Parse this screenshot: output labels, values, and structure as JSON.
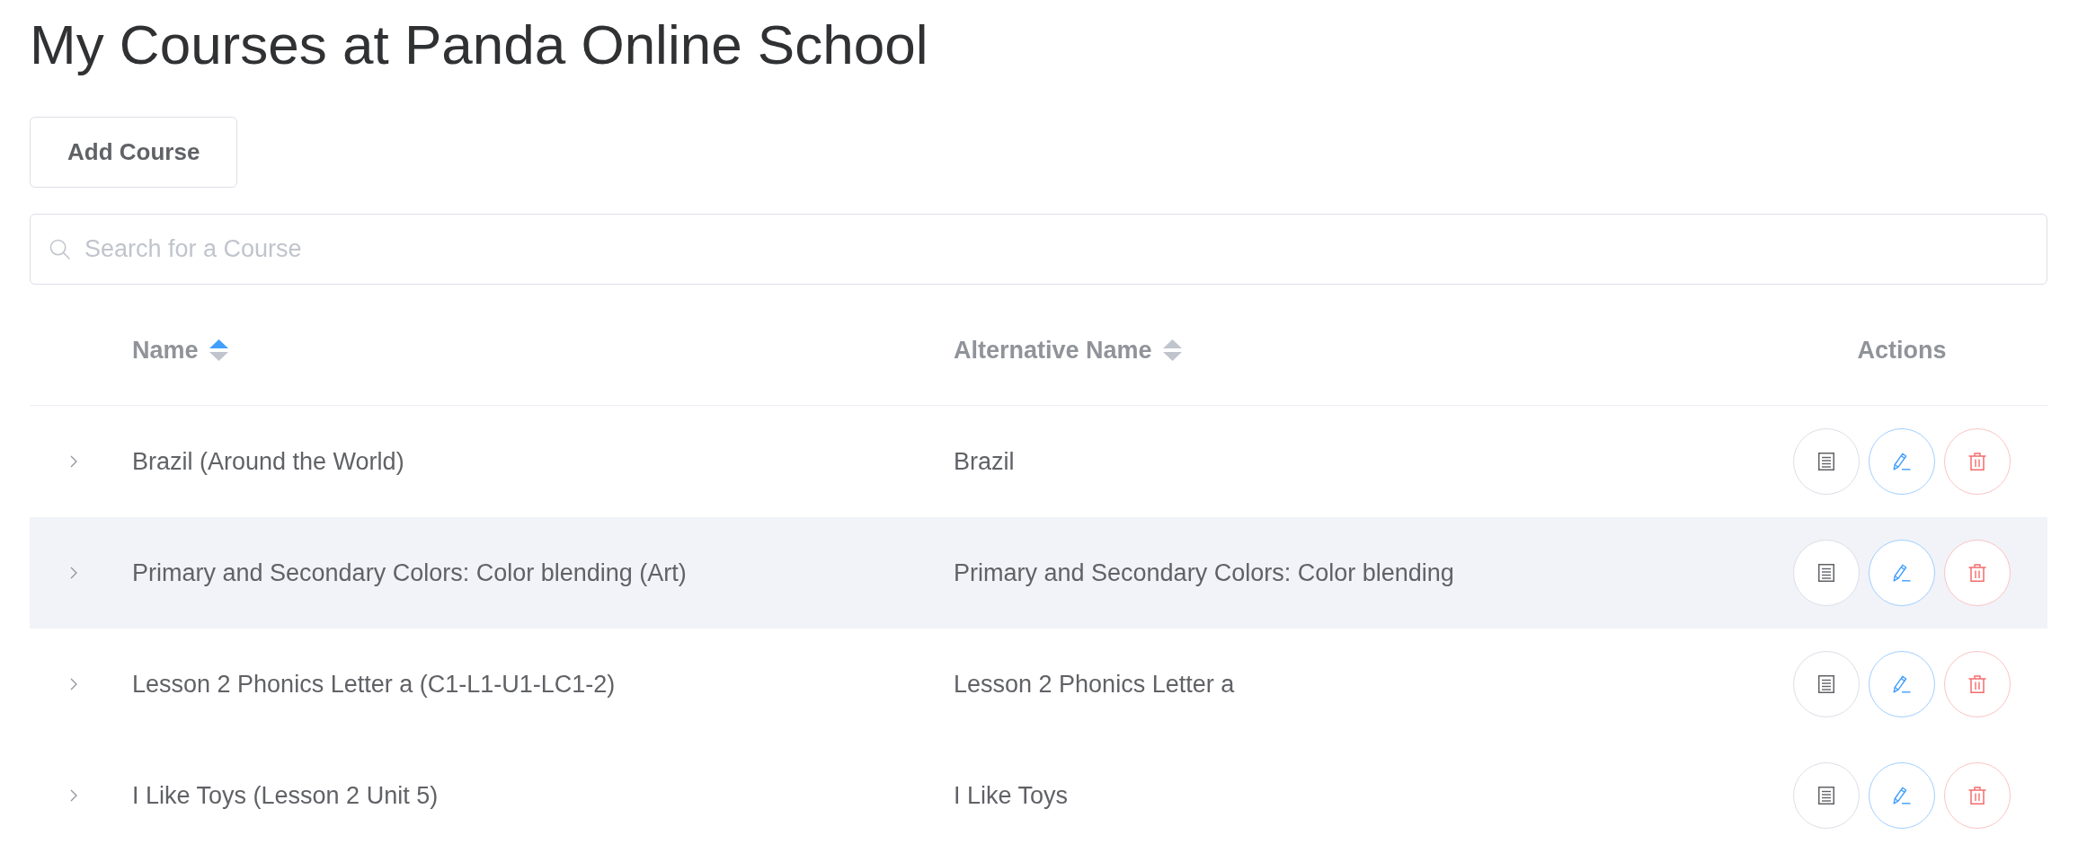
{
  "title": "My Courses at Panda Online School",
  "add_button": {
    "label": "Add Course"
  },
  "search": {
    "placeholder": "Search for a Course"
  },
  "table": {
    "columns": [
      {
        "label": "Name",
        "sorted": true
      },
      {
        "label": "Alternative Name",
        "sorted": false
      },
      {
        "label": "Actions"
      }
    ],
    "rows": [
      {
        "name": "Brazil (Around the World)",
        "alternative_name": "Brazil",
        "expanded": false,
        "highlighted": false
      },
      {
        "name": "Primary and Secondary Colors: Color blending (Art)",
        "alternative_name": "Primary and Secondary Colors: Color blending",
        "expanded": false,
        "highlighted": true
      },
      {
        "name": "Lesson 2 Phonics Letter a (C1-L1-U1-LC1-2)",
        "alternative_name": "Lesson 2 Phonics Letter a",
        "expanded": false,
        "highlighted": false
      },
      {
        "name": "I Like Toys (Lesson 2 Unit 5)",
        "alternative_name": "I Like Toys",
        "expanded": false,
        "highlighted": false
      }
    ]
  }
}
